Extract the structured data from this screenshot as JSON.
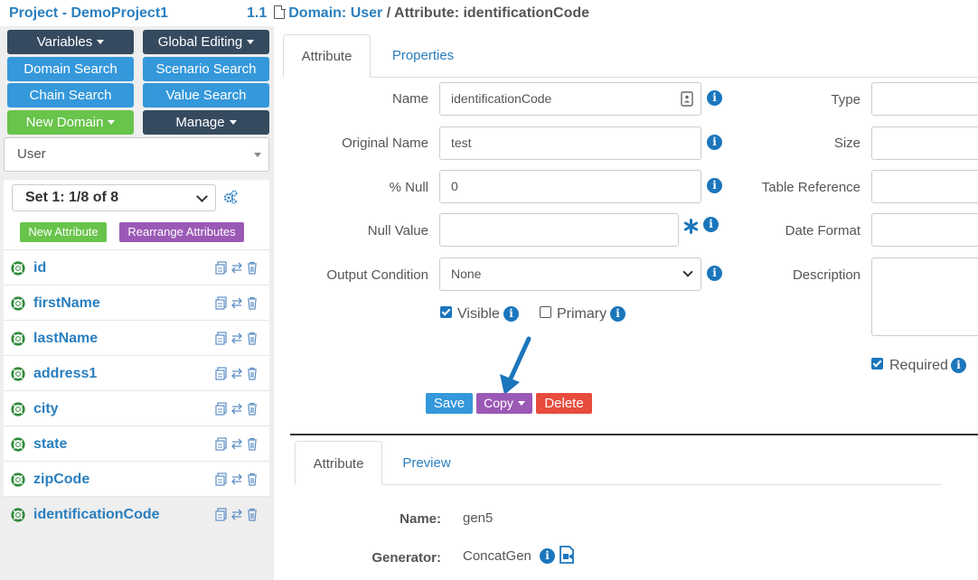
{
  "header": {
    "project_title": "Project - DemoProject1",
    "version": "1.1",
    "domain_link": "Domain: User",
    "separator": " / ",
    "attribute_title": "Attribute: identificationCode"
  },
  "sidebar": {
    "buttons": {
      "variables": "Variables",
      "global_editing": "Global Editing",
      "domain_search": "Domain Search",
      "scenario_search": "Scenario Search",
      "chain_search": "Chain Search",
      "value_search": "Value Search",
      "new_domain": "New Domain",
      "manage": "Manage"
    },
    "domain_select": "User",
    "set_select": "Set 1: 1/8 of 8",
    "new_attribute": "New Attribute",
    "rearrange_attributes": "Rearrange Attributes",
    "attributes": [
      "id",
      "firstName",
      "lastName",
      "address1",
      "city",
      "state",
      "zipCode",
      "identificationCode"
    ]
  },
  "main": {
    "tabs": [
      "Attribute",
      "Properties"
    ],
    "form": {
      "name_label": "Name",
      "name_value": "identificationCode",
      "original_name_label": "Original Name",
      "original_name_value": "test",
      "pct_null_label": "% Null",
      "pct_null_value": "0",
      "null_value_label": "Null Value",
      "null_value_value": "",
      "output_condition_label": "Output Condition",
      "output_condition_value": "None",
      "visible_label": "Visible",
      "primary_label": "Primary",
      "type_label": "Type",
      "size_label": "Size",
      "table_reference_label": "Table Reference",
      "date_format_label": "Date Format",
      "description_label": "Description",
      "required_label": "Required"
    },
    "actions": {
      "save": "Save",
      "copy": "Copy",
      "delete": "Delete"
    },
    "preview_tabs": [
      "Attribute",
      "Preview"
    ],
    "preview": {
      "name_label": "Name:",
      "name_value": "gen5",
      "generator_label": "Generator:",
      "generator_value": "ConcatGen"
    }
  },
  "colors": {
    "link_blue": "#2a7fbf",
    "dark_button": "#354a5f",
    "blue_button": "#3498db",
    "green_button": "#68c44a",
    "purple_button": "#9b59b6",
    "red_button": "#e74c3c",
    "info_blue": "#1b76bc"
  }
}
